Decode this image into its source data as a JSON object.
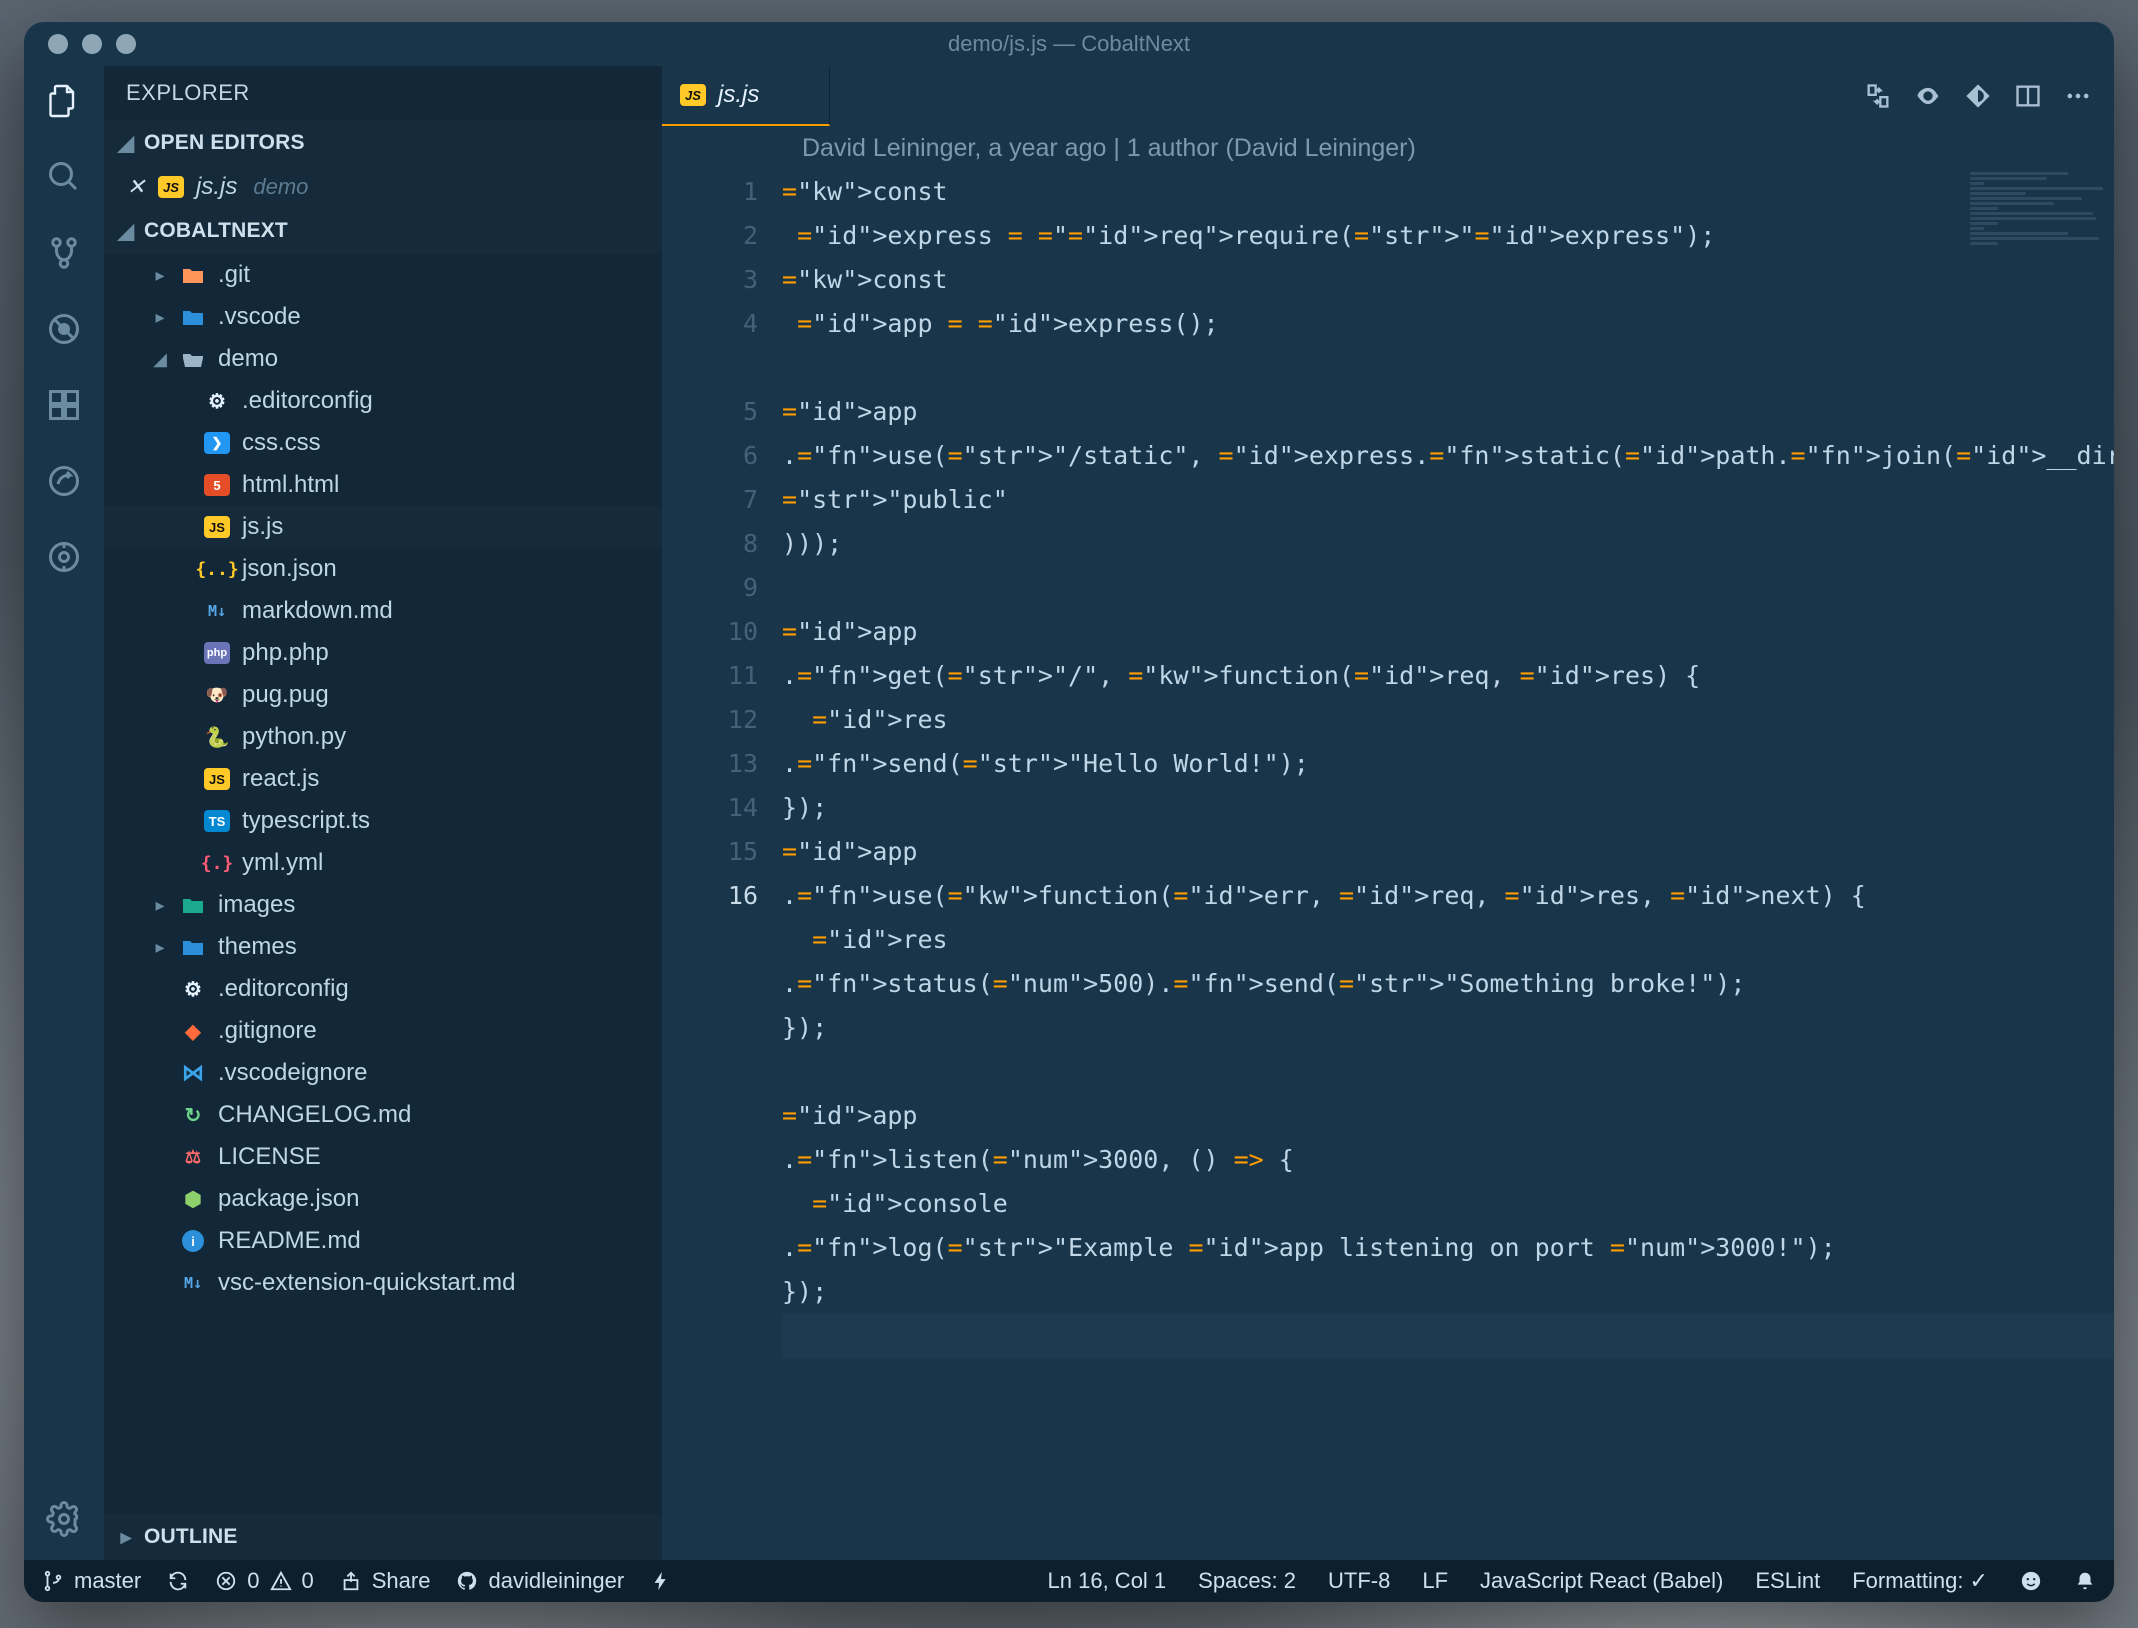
{
  "window": {
    "title": "demo/js.js — CobaltNext"
  },
  "sidebar": {
    "title": "EXPLORER",
    "sections": {
      "openEditors": "OPEN EDITORS",
      "workspace": "COBALTNEXT",
      "outline": "OUTLINE"
    },
    "openEditor": {
      "file": "js.js",
      "folder": "demo"
    },
    "tree": [
      {
        "name": ".git",
        "kind": "folder",
        "color": "#ff9559",
        "open": false,
        "lvl": 1
      },
      {
        "name": ".vscode",
        "kind": "folder",
        "color": "#2b90d9",
        "open": false,
        "lvl": 1
      },
      {
        "name": "demo",
        "kind": "folder-open",
        "color": "#9bb5c7",
        "open": true,
        "lvl": 1
      },
      {
        "name": ".editorconfig",
        "kind": "config",
        "lvl": 2
      },
      {
        "name": "css.css",
        "kind": "css",
        "lvl": 2
      },
      {
        "name": "html.html",
        "kind": "html",
        "lvl": 2
      },
      {
        "name": "js.js",
        "kind": "js",
        "lvl": 2,
        "selected": true
      },
      {
        "name": "json.json",
        "kind": "json",
        "lvl": 2
      },
      {
        "name": "markdown.md",
        "kind": "md",
        "lvl": 2
      },
      {
        "name": "php.php",
        "kind": "php",
        "lvl": 2
      },
      {
        "name": "pug.pug",
        "kind": "pug",
        "lvl": 2
      },
      {
        "name": "python.py",
        "kind": "py",
        "lvl": 2
      },
      {
        "name": "react.js",
        "kind": "js",
        "lvl": 2
      },
      {
        "name": "typescript.ts",
        "kind": "ts",
        "lvl": 2
      },
      {
        "name": "yml.yml",
        "kind": "yml",
        "lvl": 2
      },
      {
        "name": "images",
        "kind": "folder",
        "color": "#1aa890",
        "open": false,
        "lvl": 1
      },
      {
        "name": "themes",
        "kind": "folder",
        "color": "#2b90d9",
        "open": false,
        "lvl": 1
      },
      {
        "name": ".editorconfig",
        "kind": "config",
        "lvl": 1
      },
      {
        "name": ".gitignore",
        "kind": "git",
        "lvl": 1
      },
      {
        "name": ".vscodeignore",
        "kind": "vs",
        "lvl": 1
      },
      {
        "name": "CHANGELOG.md",
        "kind": "changelog",
        "lvl": 1
      },
      {
        "name": "LICENSE",
        "kind": "license",
        "lvl": 1
      },
      {
        "name": "package.json",
        "kind": "npm",
        "lvl": 1
      },
      {
        "name": "README.md",
        "kind": "info",
        "lvl": 1
      },
      {
        "name": "vsc-extension-quickstart.md",
        "kind": "md",
        "lvl": 1
      }
    ]
  },
  "tabs": {
    "active": "js.js"
  },
  "blame": "David Leininger, a year ago | 1 author (David Leininger)",
  "code": {
    "lines": 16,
    "current": 16,
    "content_plain": [
      "const express = require(\"express\");",
      "const app = express();",
      "",
      "app.use(\"/static\", express.static(path.join(__dirname, \"public\")));",
      "",
      "app.get(\"/\", function(req, res) {",
      "  res.send(\"Hello World!\");",
      "});",
      "app.use(function(err, req, res, next) {",
      "  res.status(500).send(\"Something broke!\");",
      "});",
      "",
      "app.listen(3000, () => {",
      "  console.log(\"Example app listening on port 3000!\");",
      "});",
      ""
    ]
  },
  "status": {
    "branch": "master",
    "errors": "0",
    "warnings": "0",
    "share": "Share",
    "github": "davidleininger",
    "cursor": "Ln 16, Col 1",
    "indent": "Spaces: 2",
    "encoding": "UTF-8",
    "eol": "LF",
    "lang": "JavaScript React (Babel)",
    "linter": "ESLint",
    "formatting": "Formatting: ✓"
  }
}
